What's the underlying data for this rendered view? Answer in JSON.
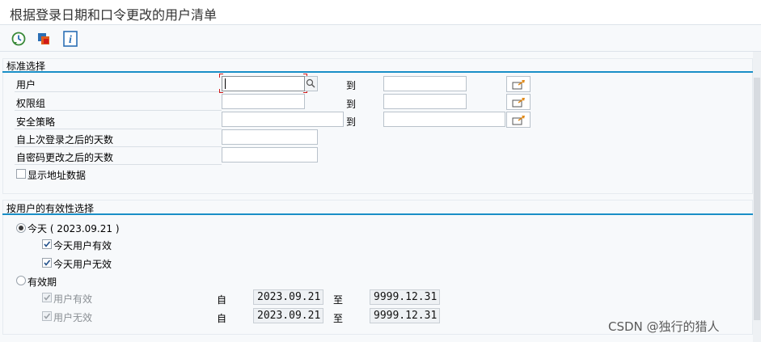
{
  "window": {
    "title": "根据登录日期和口令更改的用户清单"
  },
  "toolbar": {
    "execute_icon": "execute-clock-icon",
    "variants_icon": "variants-icon",
    "info_icon": "info-icon",
    "info_glyph": "i"
  },
  "standard_selection": {
    "title": "标准选择",
    "to_label": "到",
    "rows": [
      {
        "label": "用户",
        "low": "",
        "high": ""
      },
      {
        "label": "权限组",
        "low": "",
        "high": ""
      },
      {
        "label": "安全策略",
        "low": "",
        "high": ""
      },
      {
        "label": "自上次登录之后的天数",
        "low": ""
      },
      {
        "label": "自密码更改之后的天数",
        "low": ""
      }
    ],
    "show_address_label": "显示地址数据",
    "show_address_checked": false
  },
  "validity_selection": {
    "title": "按用户的有效性选择",
    "today_label": "今天 ( 2023.09.21 )",
    "today_selected": true,
    "today_valid_label": "今天用户有效",
    "today_valid_checked": true,
    "today_invalid_label": "今天用户无效",
    "today_invalid_checked": true,
    "period_label": "有效期",
    "period_selected": false,
    "period_valid_label": "用户有效",
    "period_invalid_label": "用户无效",
    "from_label": "自",
    "to_label": "至",
    "valid_from": "2023.09.21",
    "valid_to": "9999.12.31",
    "invalid_from": "2023.09.21",
    "invalid_to": "9999.12.31"
  },
  "watermark": "CSDN @独行的猎人",
  "colors": {
    "accent": "#1a8fc7",
    "focus_marker": "#d01a1a"
  }
}
